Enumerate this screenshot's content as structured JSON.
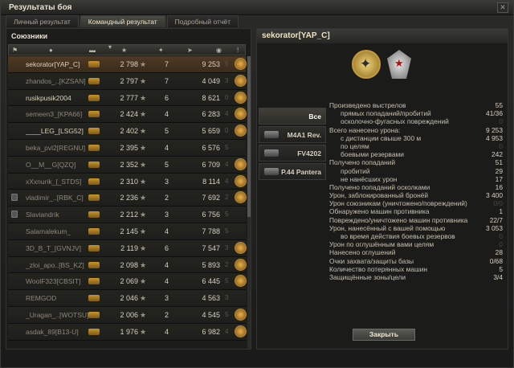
{
  "window": {
    "title": "Результаты боя",
    "close_glyph": "✕"
  },
  "tabs": [
    {
      "label": "Личный результат"
    },
    {
      "label": "Командный результат"
    },
    {
      "label": "Подробный отчёт"
    }
  ],
  "allies": {
    "heading": "Союзники",
    "rows": [
      {
        "name": "sekorator[YAP_C]",
        "xp": "2 798",
        "frags": "7",
        "damage": "9 253",
        "spotted": "5",
        "selected": true
      },
      {
        "name": "zhandos_..[KZSAN]",
        "xp": "2 797",
        "frags": "7",
        "damage": "4 049",
        "spotted": "3"
      },
      {
        "name": "rusikpusik2004",
        "xp": "2 777",
        "frags": "6",
        "damage": "8 621",
        "spotted": "0"
      },
      {
        "name": "semeen3_[KPA66]",
        "xp": "2 424",
        "frags": "4",
        "damage": "6 283",
        "spotted": "4"
      },
      {
        "name": "____LEG_[LSG52]",
        "xp": "2 402",
        "frags": "5",
        "damage": "5 659",
        "spotted": "0"
      },
      {
        "name": "beka_pvl2[REGNU]",
        "xp": "2 395",
        "frags": "4",
        "damage": "6 576",
        "spotted": "5"
      },
      {
        "name": "O__M__G[QZQ]",
        "xp": "2 352",
        "frags": "5",
        "damage": "6 709",
        "spotted": "4"
      },
      {
        "name": "xXxnurik_[_STDS]",
        "xp": "2 310",
        "frags": "3",
        "damage": "8 114",
        "spotted": "4"
      },
      {
        "name": "vladimir_..[RBK_C]",
        "xp": "2 236",
        "frags": "2",
        "damage": "7 692",
        "spotted": "2"
      },
      {
        "name": "Slaviandrik",
        "xp": "2 212",
        "frags": "3",
        "damage": "6 756",
        "spotted": "5"
      },
      {
        "name": "Salamalekum_",
        "xp": "2 145",
        "frags": "4",
        "damage": "7 788",
        "spotted": "5"
      },
      {
        "name": "3D_B_T_[GVNJV]",
        "xp": "2 119",
        "frags": "6",
        "damage": "7 547",
        "spotted": "3"
      },
      {
        "name": "_zloi_apo..[BS_KZ]",
        "xp": "2 098",
        "frags": "4",
        "damage": "5 893",
        "spotted": "2"
      },
      {
        "name": "WoolF323[CBSIT]",
        "xp": "2 069",
        "frags": "4",
        "damage": "6 445",
        "spotted": "5"
      },
      {
        "name": "REMGOD",
        "xp": "2 046",
        "frags": "3",
        "damage": "4 563",
        "spotted": "3"
      },
      {
        "name": "_Uragan_..[WOTSU]",
        "xp": "2 006",
        "frags": "2",
        "damage": "4 545",
        "spotted": "5"
      },
      {
        "name": "asdak_89[B13-U]",
        "xp": "1 976",
        "frags": "4",
        "damage": "6 982",
        "spotted": "4"
      }
    ]
  },
  "player": {
    "name": "sekorator[YAP_C]"
  },
  "vehicles": [
    {
      "label": "Все",
      "active": true
    },
    {
      "label": "M4A1 Rev."
    },
    {
      "label": "FV4202"
    },
    {
      "label": "P.44 Pantera"
    }
  ],
  "stats": [
    {
      "label": "Произведено выстрелов",
      "value": "55",
      "indent": 0
    },
    {
      "label": "прямых попаданий/пробитий",
      "value": "41/36",
      "indent": 1
    },
    {
      "label": "осколочно-фугасных повреждений",
      "value": "0",
      "indent": 1,
      "dim": true
    },
    {
      "label": "Всего нанесено урона:",
      "value": "9 253",
      "indent": 0
    },
    {
      "label": "с дистанции свыше 300 м",
      "value": "4 953",
      "indent": 1
    },
    {
      "label": "по целям",
      "value": "0",
      "indent": 1,
      "dim": true
    },
    {
      "label": "боевыми резервами",
      "value": "242",
      "indent": 1
    },
    {
      "label": "Получено попаданий",
      "value": "51",
      "indent": 0
    },
    {
      "label": "пробитий",
      "value": "29",
      "indent": 1
    },
    {
      "label": "не нанёсших урон",
      "value": "17",
      "indent": 1
    },
    {
      "label": "Получено попаданий осколками",
      "value": "16",
      "indent": 0
    },
    {
      "label": "Урон, заблокированный бронёй",
      "value": "3 400",
      "indent": 0
    },
    {
      "label": "Урон союзникам (уничтожено/повреждений)",
      "value": "0/0",
      "indent": 0,
      "dim": true
    },
    {
      "label": "Обнаружено машин противника",
      "value": "1",
      "indent": 0
    },
    {
      "label": "Повреждено/уничтожено машин противника",
      "value": "22/7",
      "indent": 0
    },
    {
      "label": "Урон, нанесённый с вашей помощью",
      "value": "3 053",
      "indent": 0
    },
    {
      "label": "во время действия боевых резервов",
      "value": "0",
      "indent": 1,
      "dim": true
    },
    {
      "label": "Урон по оглушённым вами целям",
      "value": "0",
      "indent": 0,
      "dim": true
    },
    {
      "label": "Нанесено оглушений",
      "value": "28",
      "indent": 0
    },
    {
      "label": "Очки захвата/защиты базы",
      "value": "0/68",
      "indent": 0
    },
    {
      "label": "Количество потерянных машин",
      "value": "5",
      "indent": 0
    },
    {
      "label": "Защищённые зоны/цели",
      "value": "3/4",
      "indent": 0
    }
  ],
  "buttons": {
    "close": "Закрыть"
  },
  "header_icons": [
    "flag-icon",
    "player-icon",
    "sort-icon",
    "tank-icon",
    "xp-icon",
    "frags-icon",
    "damage-icon",
    "spotted-icon",
    "medal-icon"
  ]
}
